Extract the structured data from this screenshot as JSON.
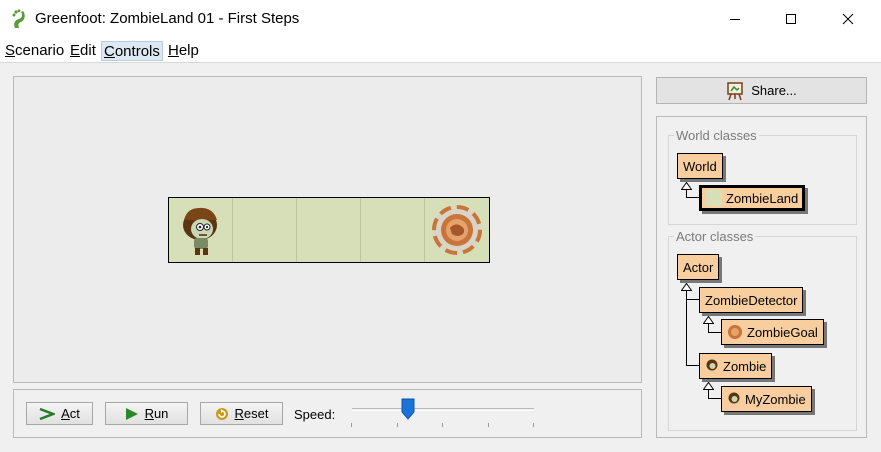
{
  "window": {
    "title": "Greenfoot: ZombieLand 01 - First Steps",
    "app_icon": "greenfoot-foot-icon",
    "controls": [
      "minimize-icon",
      "maximize-icon",
      "close-icon"
    ]
  },
  "menu": {
    "items": [
      {
        "label": "Scenario",
        "mnemonic": "S",
        "rest": "cenario"
      },
      {
        "label": "Edit",
        "mnemonic": "E",
        "rest": "dit"
      },
      {
        "label": "Controls",
        "mnemonic": "C",
        "rest": "ontrols"
      },
      {
        "label": "Help",
        "mnemonic": "H",
        "rest": "elp"
      }
    ],
    "active": "Controls"
  },
  "world": {
    "cells": 5,
    "actors": [
      {
        "name": "Zombie",
        "cell": 0,
        "icon": "zombie-icon"
      },
      {
        "name": "ZombieGoal",
        "cell": 4,
        "icon": "zombie-goal-icon"
      }
    ]
  },
  "controls": {
    "act": {
      "label": "Act",
      "mnemonic": "A",
      "rest": "ct",
      "icon": "step-arrow-icon"
    },
    "run": {
      "label": "Run",
      "mnemonic": "R",
      "rest": "un",
      "icon": "play-icon"
    },
    "reset": {
      "label": "Reset",
      "mnemonic": "R",
      "rest": "eset",
      "icon": "reset-icon"
    },
    "speed_label": "Speed:",
    "speed_value": 0.31
  },
  "share": {
    "label": "Share...",
    "icon": "easel-icon"
  },
  "classes": {
    "world_title": "World classes",
    "actor_title": "Actor classes",
    "world": [
      {
        "name": "World",
        "level": 0,
        "icon": null
      },
      {
        "name": "ZombieLand",
        "level": 1,
        "icon": "zombieland-thumb-icon",
        "selected": true
      }
    ],
    "actors": [
      {
        "name": "Actor",
        "level": 0,
        "icon": null
      },
      {
        "name": "ZombieDetector",
        "level": 1,
        "icon": null
      },
      {
        "name": "ZombieGoal",
        "level": 2,
        "icon": "zombie-goal-icon"
      },
      {
        "name": "Zombie",
        "level": 1,
        "icon": "zombie-icon"
      },
      {
        "name": "MyZombie",
        "level": 2,
        "icon": "zombie-icon"
      }
    ]
  },
  "colors": {
    "class_fill": "#f8ce9f",
    "world_grass": "#d6dfb8",
    "slider_thumb": "#1a73d8"
  }
}
